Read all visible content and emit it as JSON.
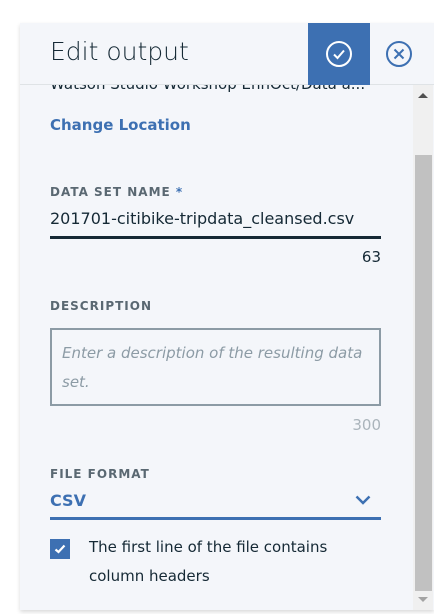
{
  "header": {
    "title": "Edit output",
    "confirm_icon": "check-circle-icon",
    "close_icon": "close-circle-icon"
  },
  "location": {
    "path": "Watson Studio Workshop EnhOct/Data a...",
    "change_label": "Change Location"
  },
  "dataset_name": {
    "label": "DATA SET NAME",
    "required_mark": "*",
    "value": "201701-citibike-tripdata_cleansed.csv",
    "remaining": "63"
  },
  "description": {
    "label": "DESCRIPTION",
    "placeholder": "Enter a description of the resulting data set.",
    "remaining": "300"
  },
  "file_format": {
    "label": "FILE FORMAT",
    "selected": "CSV"
  },
  "header_checkbox": {
    "label": "The first line of the file contains column headers",
    "checked": true
  },
  "colors": {
    "accent": "#3d70b2",
    "text": "#152935",
    "panel": "#f4f6fa"
  }
}
